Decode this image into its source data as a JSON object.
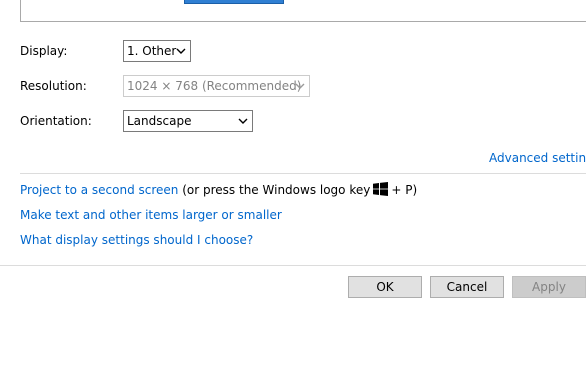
{
  "display": {
    "label": "Display:",
    "value": "1. Other"
  },
  "resolution": {
    "label": "Resolution:",
    "value": "1024 × 768 (Recommended)"
  },
  "orientation": {
    "label": "Orientation:",
    "value": "Landscape"
  },
  "links": {
    "advanced": "Advanced settings",
    "project": "Project to a second screen",
    "project_hint_before": "(or press the Windows logo key",
    "project_hint_after": "+ P)",
    "text_size": "Make text and other items larger or smaller",
    "which_settings": "What display settings should I choose?"
  },
  "buttons": {
    "ok": "OK",
    "cancel": "Cancel",
    "apply": "Apply"
  },
  "colors": {
    "link": "#0066cc",
    "accent_monitor": "#2f7fd3",
    "disabled_text": "#838383"
  },
  "icons": {
    "dropdown": "chevron-down-icon",
    "windows_key": "windows-logo-icon"
  }
}
